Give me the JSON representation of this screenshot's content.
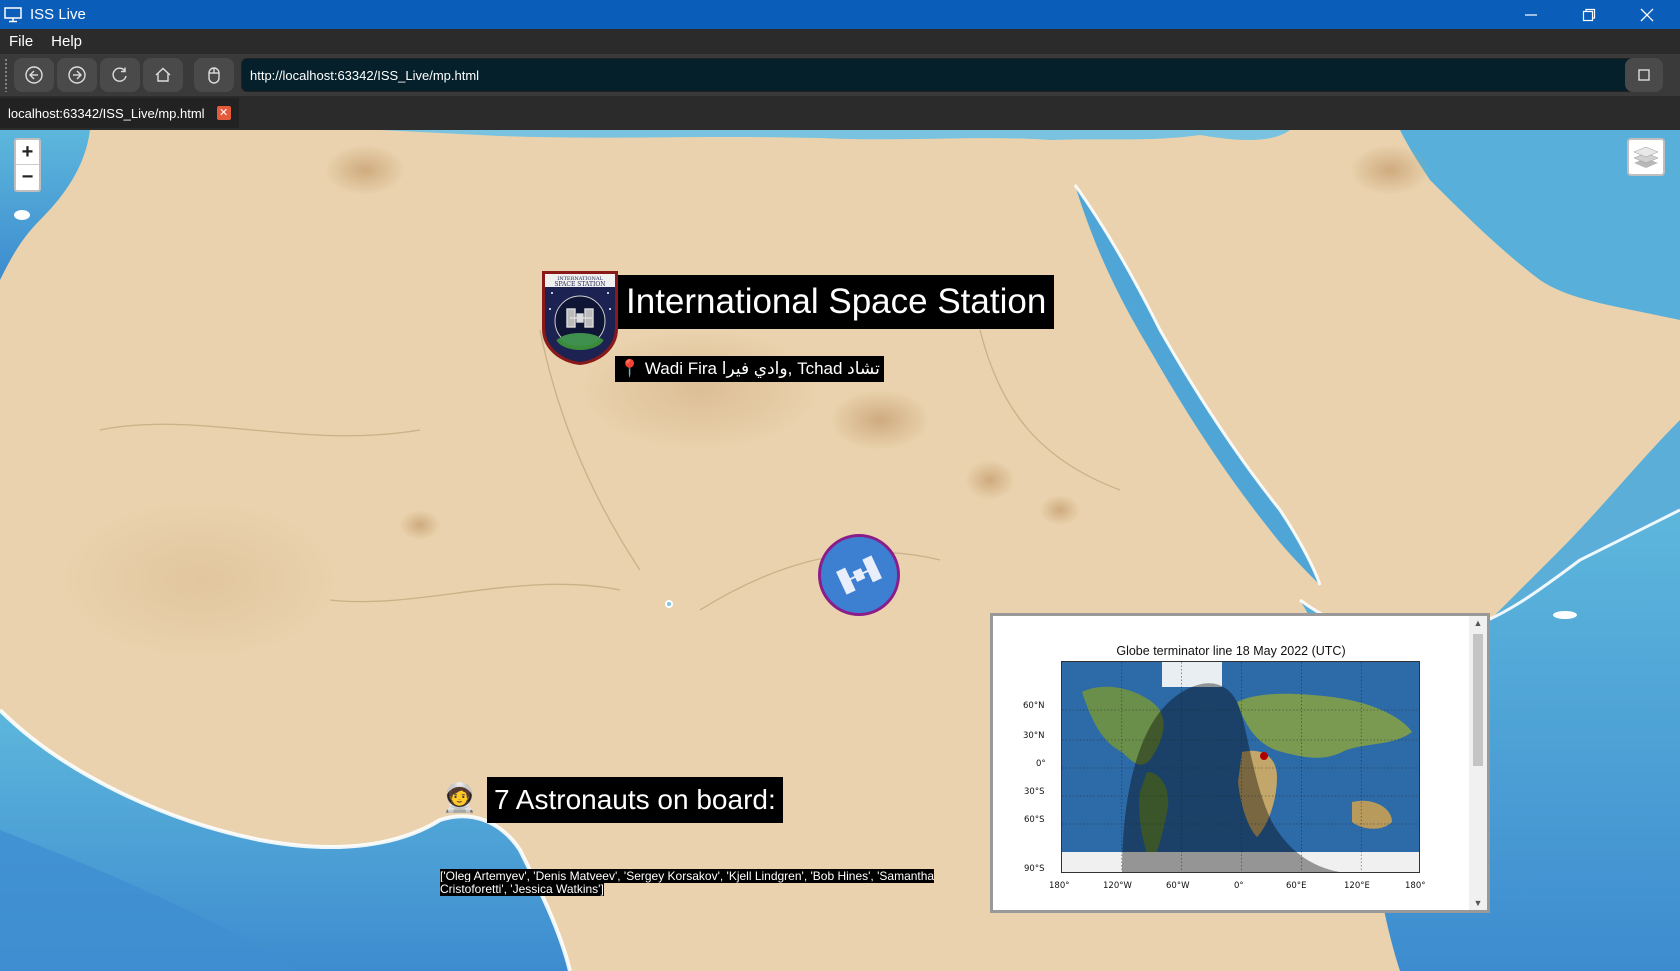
{
  "window": {
    "title": "ISS Live",
    "icon": "monitor-icon"
  },
  "menu": [
    {
      "label": "File"
    },
    {
      "label": "Help"
    }
  ],
  "toolbar": {
    "url": "http://localhost:63342/ISS_Live/mp.html",
    "buttons": [
      "back-icon",
      "forward-icon",
      "reload-icon",
      "home-icon",
      "mouse-icon",
      "stop-icon"
    ]
  },
  "tab": {
    "label": "localhost:63342/ISS_Live/mp.html",
    "close": "✕"
  },
  "map": {
    "zoom_in": "+",
    "zoom_out": "−",
    "iss_title": "International Space Station",
    "location": "📍 Wadi Fira وادي فيرا, Tchad تشاد",
    "astronaut_emoji": "🧑‍🚀",
    "astronauts_title": "7 Astronauts on board:",
    "astronauts_list": "['Oleg Artemyev', 'Denis Matveev', 'Sergey Korsakov', 'Kjell Lindgren', 'Bob Hines', 'Samantha Cristoforetti', 'Jessica Watkins']"
  },
  "colors": {
    "titlebar": "#0a5db8",
    "land": "#e9d2ad",
    "water": "#5ab0d8",
    "marker_fill": "#3d7fd1",
    "marker_border": "#8b1d8b"
  },
  "popup": {
    "chart_title": "Globe terminator line 18 May 2022 (UTC)",
    "lat_labels": [
      "60°N",
      "30°N",
      "0°",
      "30°S",
      "60°S",
      "90°S"
    ],
    "lon_labels": [
      "180°",
      "120°W",
      "60°W",
      "0°",
      "60°E",
      "120°E",
      "180°"
    ]
  }
}
